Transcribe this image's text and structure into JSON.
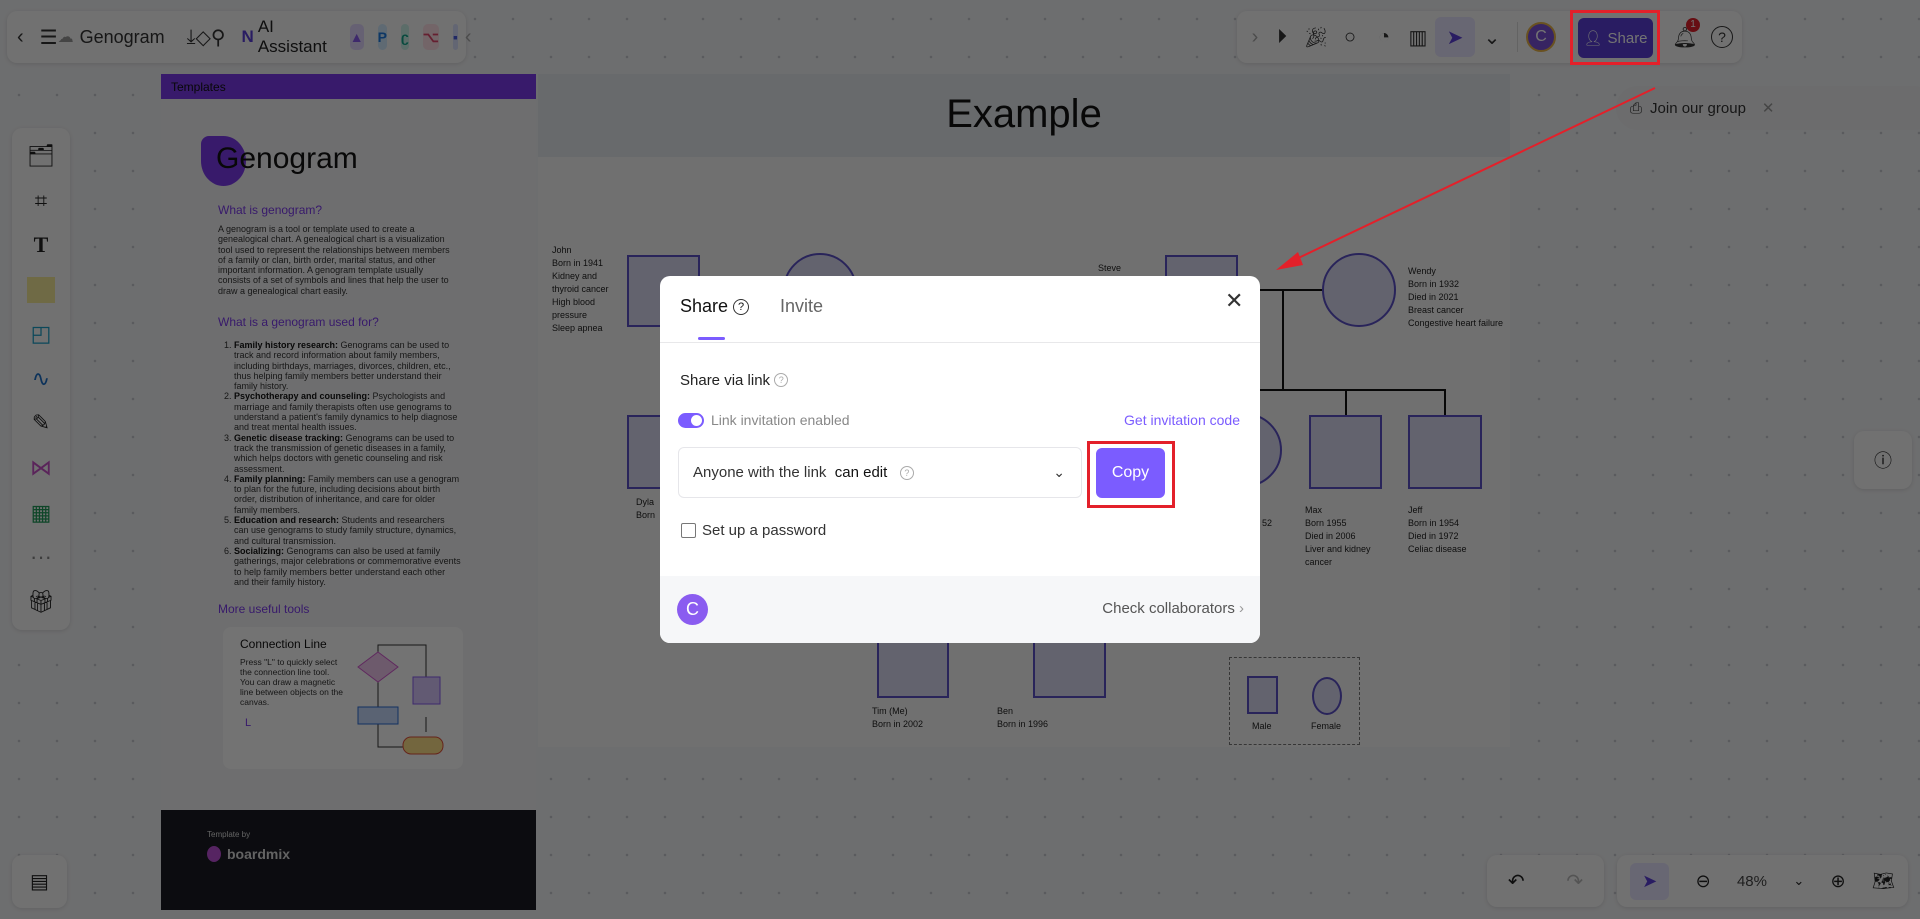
{
  "topbar": {
    "title": "Genogram",
    "ai_label": "AI Assistant",
    "share_label": "Share",
    "avatar_letter": "C",
    "notification_count": "1"
  },
  "join_group": "Join our group",
  "template_panel": {
    "header": "Templates",
    "title": "Genogram",
    "h1": "What is genogram?",
    "intro": "A genogram is a tool or template used to create a genealogical chart. A genealogical chart is a visualization tool used to represent the relationships between members of a family or clan, birth order, marital status, and other important information. A genogram template usually consists of a set of symbols and lines that help the user to draw a genealogical chart easily.",
    "h2": "What is a genogram used for?",
    "uses": [
      {
        "t": "Family history research:",
        "d": " Genograms can be used to track and record information about family members, including birthdays, marriages, divorces, children, etc., thus helping family members better understand their family history."
      },
      {
        "t": "Psychotherapy and counseling:",
        "d": " Psychologists and marriage and family therapists often use genograms to understand a patient's family dynamics to help diagnose and treat mental health issues."
      },
      {
        "t": "Genetic disease tracking:",
        "d": " Genograms can be used to track the transmission of genetic diseases in a family, which helps doctors with genetic counseling and risk assessment."
      },
      {
        "t": "Family planning:",
        "d": " Family members can use a genogram to plan for the future, including decisions about birth order, distribution of inheritance, and care for older family members."
      },
      {
        "t": "Education and research:",
        "d": " Students and researchers can use genograms to study family structure, dynamics, and cultural transmission."
      },
      {
        "t": "Socializing:",
        "d": " Genograms can also be used at family gatherings, major celebrations or commemorative events to help family members better understand each other and their family history."
      }
    ],
    "h3": "More useful tools",
    "card_title": "Connection Line",
    "card_text": "Press \"L\" to quickly select the connection line tool. You can draw a magnetic line between objects on the canvas.",
    "card_key": "L",
    "footer_by": "Template by",
    "footer_brand": "boardmix"
  },
  "canvas": {
    "title": "Example",
    "john": "John\nBorn in 1941\nKidney and\nthyroid cancer\nHigh blood\npressure\nSleep apnea",
    "steve": "Steve",
    "wendy": "Wendy\nBorn in 1932\nDied in 2021\nBreast cancer\nCongestive heart failure",
    "dylan": "Dyla\nBorn",
    "partial": "52",
    "max": "Max\nBorn 1955\nDied in 2006\nLiver and kidney\ncancer",
    "jeff": "Jeff\nBorn in 1954\nDied in 1972\nCeliac disease",
    "tim": "Tim (Me)\nBorn in 2002",
    "ben": "Ben\nBorn in 1996",
    "legend_male": "Male",
    "legend_female": "Female"
  },
  "modal": {
    "tab_share": "Share",
    "tab_invite": "Invite",
    "section": "Share via link",
    "toggle_label": "Link invitation enabled",
    "toggle_on": true,
    "invite_code": "Get invitation code",
    "perm_prefix": "Anyone with the link",
    "perm_value": "can edit",
    "copy": "Copy",
    "password_label": "Set up a password",
    "password_checked": false,
    "avatar_letter": "C",
    "collaborators": "Check collaborators"
  },
  "zoom": {
    "level": "48%"
  },
  "colors": {
    "accent": "#7b5cff",
    "share_button": "#5b3fd9",
    "highlight": "#e3202a"
  }
}
